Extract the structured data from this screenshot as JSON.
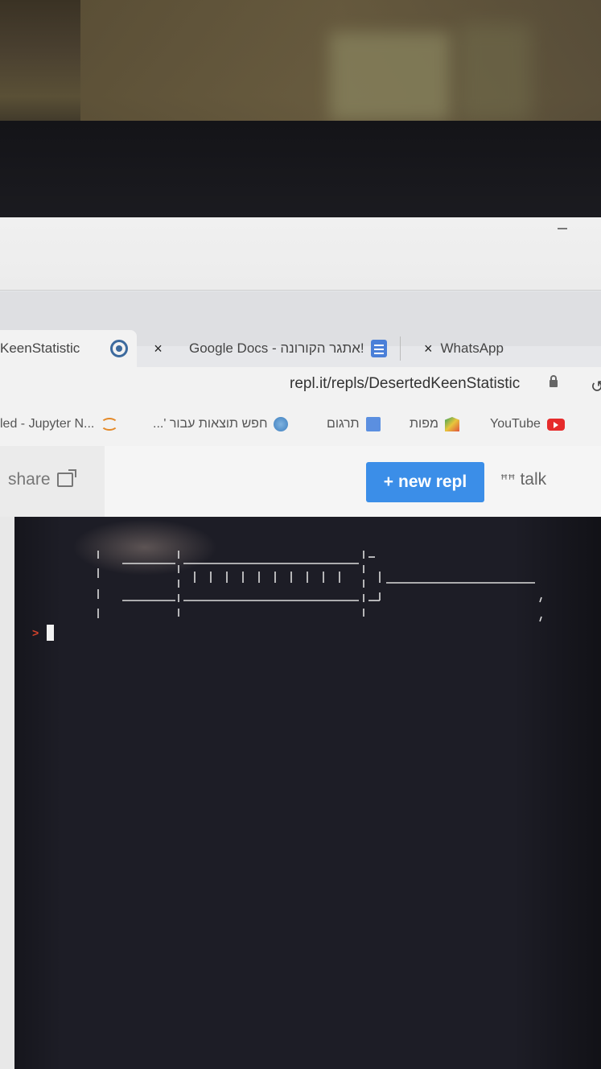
{
  "browser": {
    "tabs": [
      {
        "label": "KeenStatistic",
        "active": true
      },
      {
        "label": "Google Docs - אתגר הקורונה!",
        "active": false
      },
      {
        "label": "WhatsApp",
        "active": false
      }
    ],
    "close_symbol": "×",
    "tab_close_symbol": "×",
    "url": "repl.it/repls/DesertedKeenStatistic",
    "bookmarks": [
      {
        "label": "led - Jupyter N...",
        "icon": "jupyter-icon"
      },
      {
        "label": "חפש תוצאות עבור '...",
        "icon": "globe-icon"
      },
      {
        "label": "תרגום",
        "icon": "translate-icon"
      },
      {
        "label": "מפות",
        "icon": "maps-icon"
      },
      {
        "label": "YouTube",
        "icon": "youtube-icon"
      }
    ]
  },
  "repl": {
    "share_label": "share",
    "new_repl_label": "new repl",
    "new_repl_plus": "+",
    "talk_label": "talk",
    "prompt_symbol": ">"
  },
  "colors": {
    "accent": "#3b8ee8",
    "console_bg": "#1d1d26",
    "prompt": "#d5432c"
  }
}
